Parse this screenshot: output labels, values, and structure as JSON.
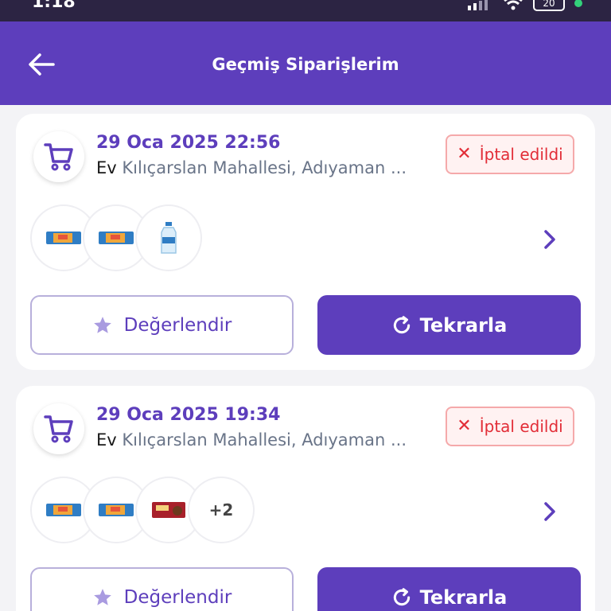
{
  "status_bar": {
    "time": "1:18",
    "battery": "20"
  },
  "header": {
    "title": "Geçmiş Siparişlerim",
    "back_icon": "arrow-left-icon"
  },
  "colors": {
    "primary": "#5d3ebc",
    "cancel_red": "#e22d37",
    "cancel_bg": "#fff2f2"
  },
  "orders": [
    {
      "date": "29 Oca 2025 22:56",
      "address_type": "Ev",
      "address": "Kılıçarslan Mahallesi, Adıyaman ...",
      "status": "İptal edildi",
      "products": [
        "wafer-icon",
        "wafer-icon",
        "water-bottle-icon"
      ],
      "more_count": "",
      "rate_label": "Değerlendir",
      "repeat_label": "Tekrarla"
    },
    {
      "date": "29 Oca 2025 19:34",
      "address_type": "Ev",
      "address": "Kılıçarslan Mahallesi, Adıyaman ...",
      "status": "İptal edildi",
      "products": [
        "wafer-icon",
        "wafer-icon",
        "chocolate-bar-icon"
      ],
      "more_count": "+2",
      "rate_label": "Değerlendir",
      "repeat_label": "Tekrarla"
    }
  ]
}
